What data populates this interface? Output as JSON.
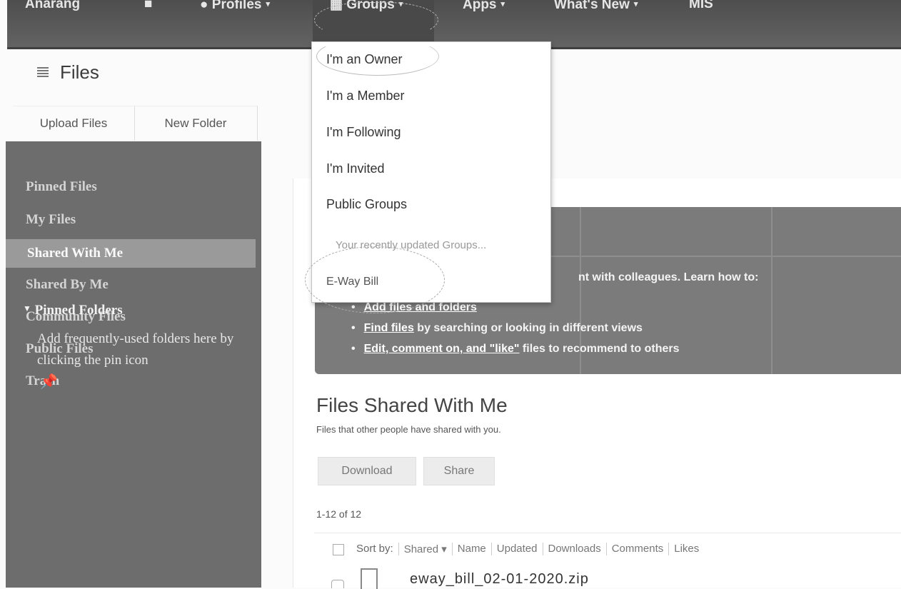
{
  "nav": {
    "brand": "Anarang",
    "home_icon": "home-icon",
    "profiles_label": "Profiles",
    "groups_label": "Groups",
    "apps_label": "Apps",
    "whats_new_label": "What's New",
    "mis_label": "MIS",
    "caret": "▾"
  },
  "files": {
    "title": "Files",
    "upload_label": "Upload Files",
    "new_folder_label": "New Folder"
  },
  "sidebar": {
    "items": [
      {
        "label": "Pinned Files"
      },
      {
        "label": "My Files"
      },
      {
        "label": "Shared With Me"
      },
      {
        "label": "Shared By Me"
      },
      {
        "label": "Community Files"
      },
      {
        "label": "Public Files"
      },
      {
        "label": "Trash"
      }
    ],
    "active_item": "Shared With Me",
    "pinned_folders": "Pinned Folders",
    "pinned_hint": "Add frequently-used folders here by clicking the pin icon",
    "pin_glyph": "✖"
  },
  "dropdown": {
    "items": [
      "I'm an Owner",
      "I'm a Member",
      "I'm Following",
      "I'm Invited",
      "Public Groups"
    ],
    "recent_hint": "Your recently updated Groups...",
    "recent_group": "E-Way Bill"
  },
  "banner": {
    "intro": "nt with colleagues. Learn how to:",
    "bullets": [
      {
        "link": "Add files and folders",
        "rest": ""
      },
      {
        "link": "Find files",
        "rest": " by searching or looking in different views"
      },
      {
        "link": "Edit, comment on, and \"like\"",
        "rest": " files to recommend to others"
      }
    ]
  },
  "main": {
    "heading": "Files Shared With Me",
    "subheading": "Files that other people have shared with you.",
    "download_label": "Download",
    "share_label": "Share",
    "count": "1-12 of 12",
    "sort_by": "Sort by:",
    "sort_options": [
      "Shared ▾",
      "Name",
      "Updated",
      "Downloads",
      "Comments",
      "Likes"
    ],
    "first_file": "eway_bill_02-01-2020.zip"
  }
}
